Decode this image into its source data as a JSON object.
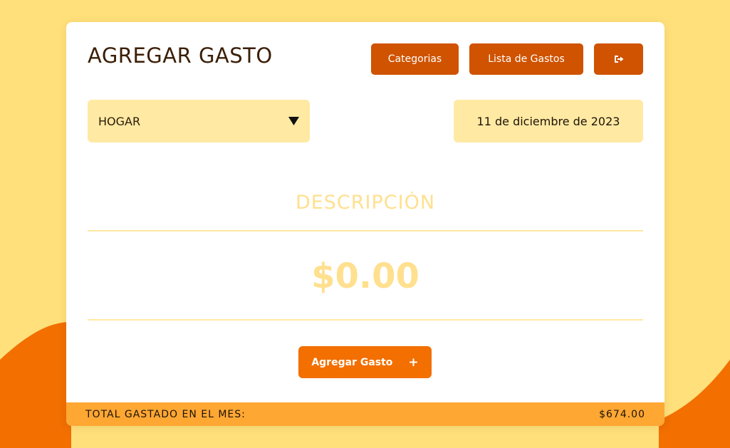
{
  "header": {
    "title": "AGREGAR GASTO",
    "categorias_label": "Categorias",
    "lista_label": "Lista de Gastos",
    "logout_icon": "logout-icon"
  },
  "form": {
    "category_value": "HOGAR",
    "category_caret_icon": "caret-down-icon",
    "date_value": "11 de diciembre de 2023",
    "description_placeholder": "DESCRIPCIÓN",
    "amount_placeholder": "$0.00",
    "submit_label": "Agregar Gasto",
    "submit_icon": "plus-icon"
  },
  "footer": {
    "total_label": "TOTAL GASTADO EN EL MES:",
    "total_value": "$674.00"
  },
  "colors": {
    "background": "#ffe07a",
    "wave": "#f26f00",
    "accent_dark": "#cf5300",
    "accent": "#f26f00",
    "field_bg": "#ffe9a3",
    "footer_bg": "#ffa733"
  }
}
